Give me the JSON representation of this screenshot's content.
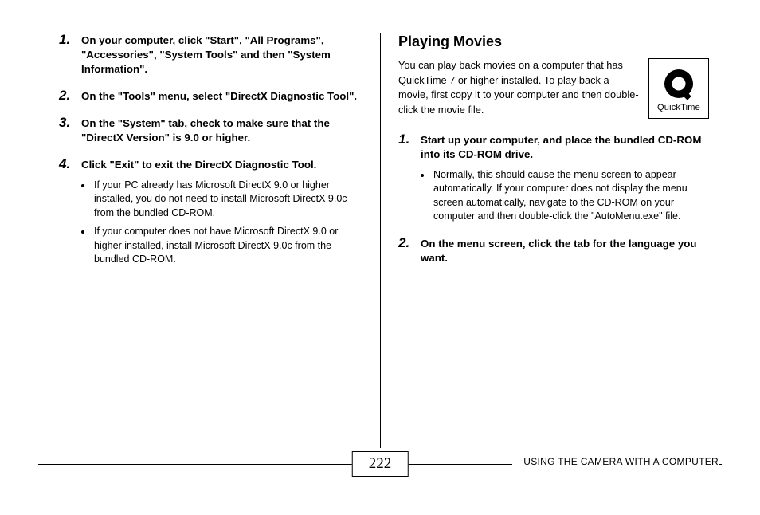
{
  "left": {
    "steps": [
      {
        "text": "On your computer, click \"Start\", \"All Programs\", \"Accessories\", \"System Tools\" and then \"System Information\"."
      },
      {
        "text": "On the \"Tools\" menu, select \"DirectX Diagnostic Tool\"."
      },
      {
        "text": "On the \"System\" tab, check to make sure that the \"DirectX Version\" is 9.0 or higher."
      },
      {
        "text": "Click \"Exit\" to exit the DirectX Diagnostic Tool.",
        "sub": [
          "If your PC already has Microsoft DirectX 9.0 or higher installed, you do not need to install Microsoft DirectX 9.0c from the bundled CD-ROM.",
          "If your computer does not have Microsoft DirectX 9.0 or higher installed, install Microsoft DirectX 9.0c from the bundled CD-ROM."
        ]
      }
    ]
  },
  "right": {
    "title": "Playing Movies",
    "intro": "You can play back movies on a computer that has QuickTime 7 or higher installed. To play back a movie, first copy it to your computer and then double-click the movie file.",
    "qt_label": "QuickTime",
    "steps": [
      {
        "text": "Start up your computer, and place the bundled CD-ROM into its CD-ROM drive.",
        "sub": [
          "Normally, this should cause the menu screen to appear automatically. If your computer does not display the menu screen automatically, navigate to the CD-ROM on your computer and then double-click the \"AutoMenu.exe\" file."
        ]
      },
      {
        "text": "On the menu screen, click the tab for the language you want."
      }
    ]
  },
  "footer": {
    "page_number": "222",
    "section": "USING THE CAMERA WITH A COMPUTER"
  }
}
